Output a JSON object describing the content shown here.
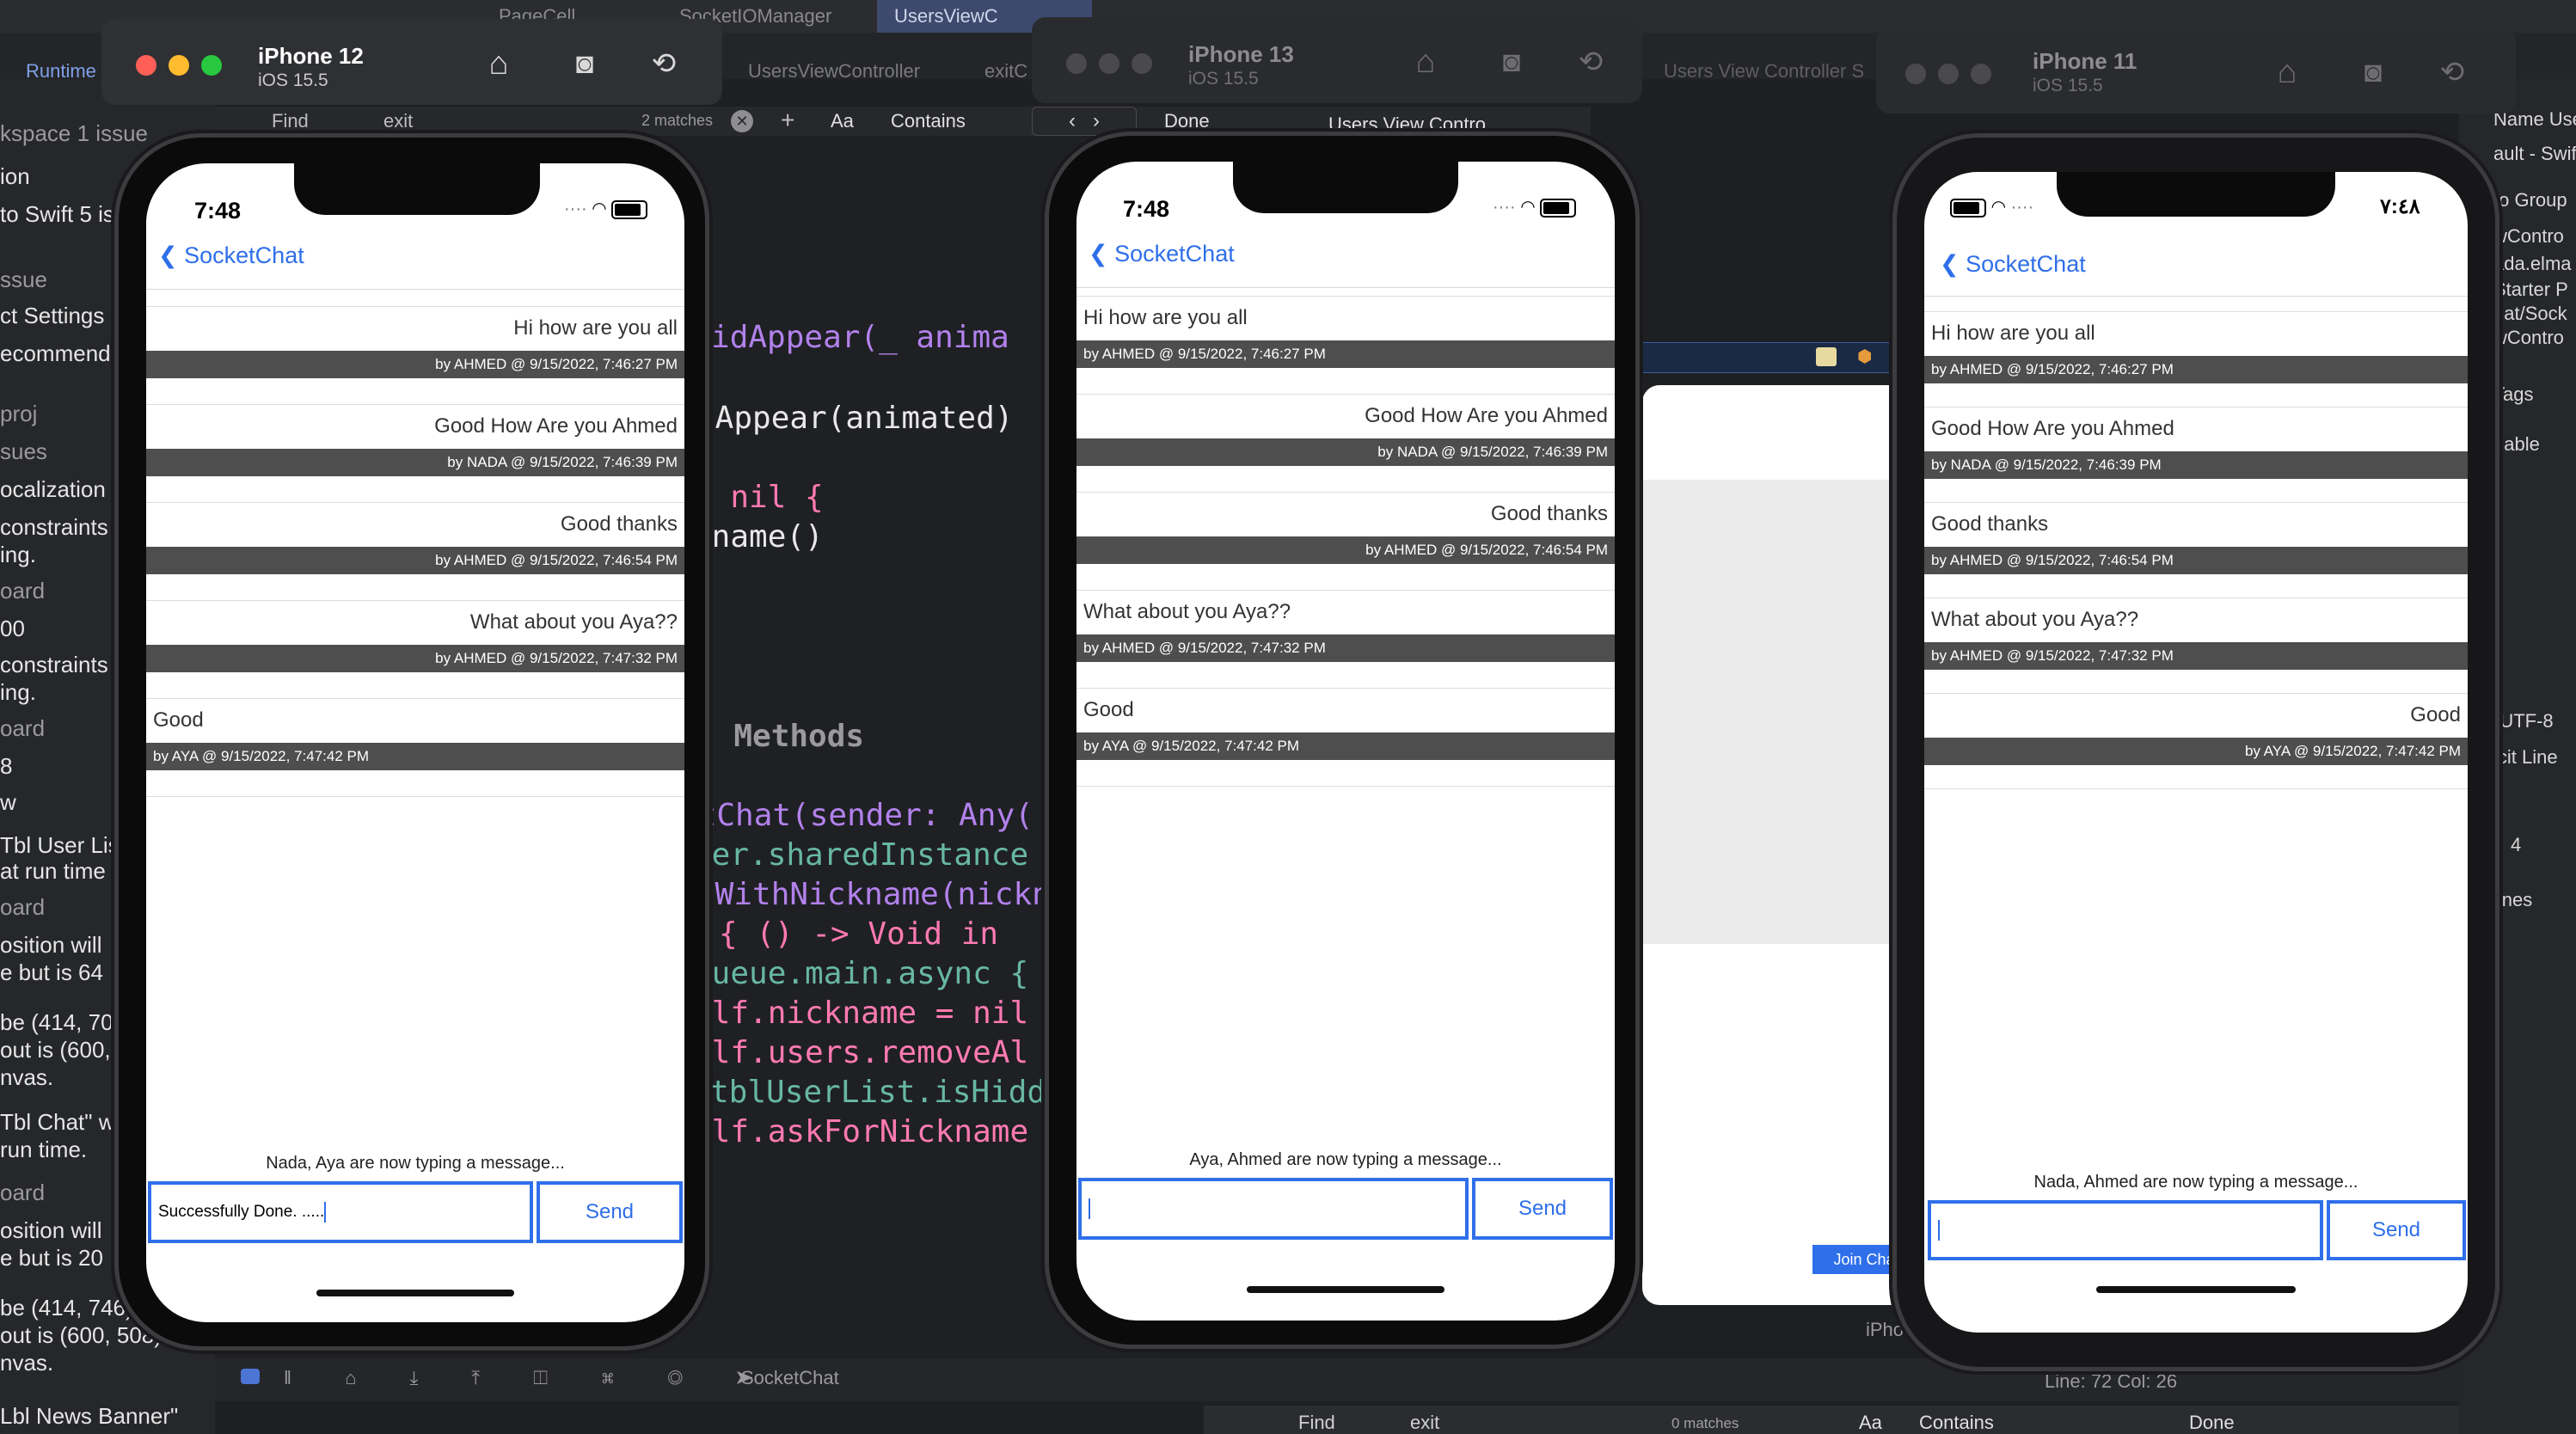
{
  "xcode": {
    "tabs": [
      "PageCell",
      "SocketIOManager",
      "UsersViewC"
    ],
    "breadcrumb": "UsersViewController",
    "breadcrumb2": "exitC",
    "scheme_label": "Runtime",
    "find": {
      "label": "Find",
      "query": "exit",
      "matches": "2 matches",
      "aa": "Aa",
      "mode": "Contains",
      "done": "Done",
      "crumb": "Users View Contro"
    },
    "find_bottom": {
      "label": "Find",
      "query": "exit",
      "matches": "0 matches",
      "aa": "Aa",
      "mode": "Contains",
      "done": "Done"
    },
    "navigator_lines": [
      "kspace  1 issue",
      "ion",
      "to Swift 5 is",
      "ssue",
      "ct Settings",
      "ecommend",
      "proj",
      "sues",
      "ocalization",
      "constraints",
      "ing.",
      "oard",
      "00",
      "constraints",
      "ing.",
      "oard",
      "8",
      "w",
      "Tbl User Lis",
      "at run time",
      "oard",
      "osition will",
      "e but is 64",
      "be (414, 70",
      "out is (600,",
      "nvas.",
      "Tbl Chat\" w",
      "run time.",
      "oard",
      "osition will",
      "e but is 20",
      "be (414, 746)",
      "out is (600, 508)",
      "nvas.",
      "Lbl News Banner\""
    ],
    "inspector_lines": [
      "Name  UsersViewContr",
      "ault - Swift S",
      "to Group",
      "wContro",
      "ada.elma",
      "Starter P",
      "nat/Sock",
      "wContro",
      "Tags",
      "gable",
      "(UTF-8",
      "icit Line",
      "4",
      "lines"
    ],
    "code_lines": [
      "ewDidAppear(_ anima",
      "dAppear(animated)",
      "= nil {",
      "kname()",
      "n Methods",
      "itChat(sender: Any(",
      "ger.sharedInstance",
      "tWithNickname(nickn",
      "{ () -> Void in",
      "Queue.main.async {",
      "elf.nickname = nil",
      "elf.users.removeAl",
      "tblUserList.isHidd",
      "elf.askForNickname"
    ],
    "status_scheme": "SocketChat",
    "line_col": "Line: 72  Col: 26",
    "ib_join": "Join Cha",
    "ib_device": "iPho"
  },
  "simulators": [
    {
      "name": "iPhone 12",
      "os": "iOS 15.5",
      "state": "active",
      "time": "7:48",
      "nav_back": "SocketChat",
      "align": "right",
      "messages": [
        {
          "text": "Hi how are you all",
          "meta": "by AHMED @ 9/15/2022, 7:46:27 PM"
        },
        {
          "text": "Good How Are you Ahmed",
          "meta": "by NADA @ 9/15/2022, 7:46:39 PM"
        },
        {
          "text": "Good thanks",
          "meta": "by AHMED @ 9/15/2022, 7:46:54 PM"
        },
        {
          "text": "What about you Aya??",
          "meta": "by AHMED @ 9/15/2022, 7:47:32 PM"
        },
        {
          "text": "Good",
          "meta": "by AYA @ 9/15/2022, 7:47:42 PM",
          "align": "left"
        }
      ],
      "typing": "Nada, Aya are now typing a message...",
      "input_value": "Successfully Done. .....",
      "send": "Send"
    },
    {
      "name": "iPhone 13",
      "os": "iOS 15.5",
      "state": "inactive",
      "time": "7:48",
      "nav_back": "SocketChat",
      "messages": [
        {
          "text": "Hi how are you all",
          "meta": "by AHMED @ 9/15/2022, 7:46:27 PM",
          "align": "left"
        },
        {
          "text": "Good How Are you Ahmed",
          "meta": "by NADA @ 9/15/2022, 7:46:39 PM",
          "align": "right"
        },
        {
          "text": "Good thanks",
          "meta": "by AHMED @ 9/15/2022, 7:46:54 PM",
          "align": "right"
        },
        {
          "text": "What about you Aya??",
          "meta": "by AHMED @ 9/15/2022, 7:47:32 PM",
          "align": "left"
        },
        {
          "text": "Good",
          "meta": "by AYA @ 9/15/2022, 7:47:42 PM",
          "align": "left"
        }
      ],
      "typing": "Aya, Ahmed are now typing a message...",
      "input_value": "",
      "send": "Send"
    },
    {
      "name": "iPhone 11",
      "os": "iOS 15.5",
      "state": "inactive",
      "time": "٧:٤٨",
      "nav_back": "SocketChat",
      "messages": [
        {
          "text": "Hi how are you all",
          "meta": "by AHMED @ 9/15/2022, 7:46:27 PM",
          "align": "left"
        },
        {
          "text": "Good How Are you Ahmed",
          "meta": "by NADA @ 9/15/2022, 7:46:39 PM",
          "align": "left"
        },
        {
          "text": "Good thanks",
          "meta": "by AHMED @ 9/15/2022, 7:46:54 PM",
          "align": "left"
        },
        {
          "text": "What about you Aya??",
          "meta": "by AHMED @ 9/15/2022, 7:47:32 PM",
          "align": "left"
        },
        {
          "text": "Good",
          "meta": "by AYA @ 9/15/2022, 7:47:42 PM",
          "align": "right"
        }
      ],
      "typing": "Nada, Ahmed are now typing a message...",
      "input_value": "",
      "send": "Send"
    }
  ],
  "icons": {
    "home": "home-icon",
    "screenshot": "camera-icon",
    "rotate": "rotate-icon"
  },
  "colors": {
    "accent": "#2f6fea",
    "meta_bg": "#4e4e4e",
    "close": "#ff5f57",
    "min": "#febc2e",
    "max": "#28c840"
  }
}
